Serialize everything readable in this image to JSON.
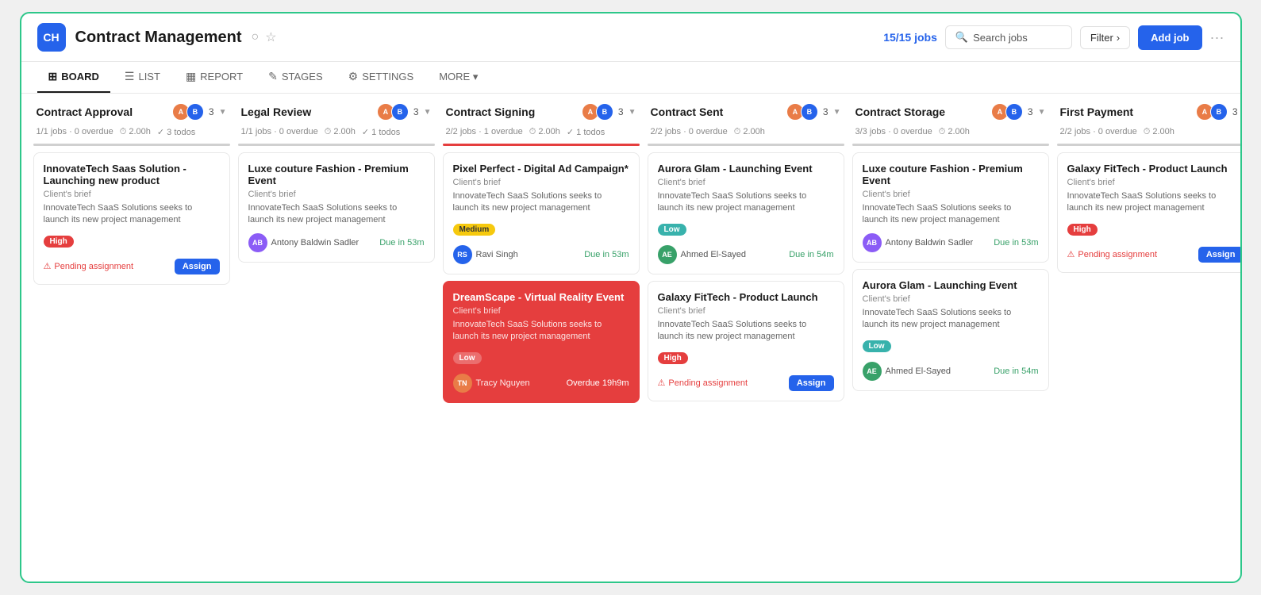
{
  "app": {
    "logo": "CH",
    "title": "Contract Management",
    "jobs_count": "15/15 jobs",
    "search_placeholder": "Search jobs",
    "filter_label": "Filter",
    "add_job_label": "Add job"
  },
  "nav": {
    "tabs": [
      {
        "id": "board",
        "label": "BOARD",
        "icon": "⊞",
        "active": true
      },
      {
        "id": "list",
        "label": "LIST",
        "icon": "☰",
        "active": false
      },
      {
        "id": "report",
        "label": "REPORT",
        "icon": "▦",
        "active": false
      },
      {
        "id": "stages",
        "label": "STAGES",
        "icon": "✎",
        "active": false
      },
      {
        "id": "settings",
        "label": "SETTINGS",
        "icon": "⚙",
        "active": false
      },
      {
        "id": "more",
        "label": "MORE",
        "icon": "",
        "active": false
      }
    ]
  },
  "columns": [
    {
      "id": "contract-approval",
      "title": "Contract Approval",
      "color": "#cccccc",
      "count": 3,
      "stats": "1/1 jobs · 0 overdue",
      "time": "2.00h",
      "todos": "3 todos",
      "cards": [
        {
          "id": "ca1",
          "title": "InnovateTech Saas Solution - Launching new product",
          "label": "Client's brief",
          "desc": "InnovateTech SaaS Solutions seeks to launch its new project management",
          "priority": "high",
          "priority_label": "High",
          "assignee": null,
          "due": null,
          "pending": true,
          "assign_label": "Assign"
        }
      ]
    },
    {
      "id": "legal-review",
      "title": "Legal Review",
      "color": "#cccccc",
      "count": 3,
      "stats": "1/1 jobs · 0 overdue",
      "time": "2.00h",
      "todos": "1 todos",
      "cards": [
        {
          "id": "lr1",
          "title": "Luxe couture Fashion - Premium Event",
          "label": "Client's brief",
          "desc": "InnovateTech SaaS Solutions seeks to launch its new project management",
          "priority": null,
          "priority_label": null,
          "assignee": "Antony Baldwin Sadler",
          "assignee_initials": "AB",
          "assignee_color": "#8b5cf6",
          "due": "Due in 53m",
          "due_type": "green",
          "pending": false
        }
      ]
    },
    {
      "id": "contract-signing",
      "title": "Contract Signing",
      "color": "#e53e3e",
      "count": 3,
      "stats": "2/2 jobs · 1 overdue",
      "time": "2.00h",
      "todos": "1 todos",
      "cards": [
        {
          "id": "cs1",
          "title": "Pixel Perfect - Digital Ad Campaign*",
          "label": "Client's brief",
          "desc": "InnovateTech SaaS Solutions seeks to launch its new project management",
          "priority": "medium",
          "priority_label": "Medium",
          "assignee": "Ravi Singh",
          "assignee_initials": "RS",
          "assignee_color": "#2563eb",
          "due": "Due in 53m",
          "due_type": "green",
          "pending": false,
          "highlighted": false
        },
        {
          "id": "cs2",
          "title": "DreamScape - Virtual Reality Event",
          "label": "Client's brief",
          "desc": "InnovateTech SaaS Solutions seeks to launch its new project management",
          "priority": "low",
          "priority_label": "Low",
          "assignee": "Tracy Nguyen",
          "assignee_initials": "TN",
          "assignee_color": "#e97c47",
          "due": "Overdue 19h9m",
          "due_type": "red",
          "pending": false,
          "highlighted": true
        }
      ]
    },
    {
      "id": "contract-sent",
      "title": "Contract Sent",
      "color": "#cccccc",
      "count": 3,
      "stats": "2/2 jobs · 0 overdue",
      "time": "2.00h",
      "todos": null,
      "cards": [
        {
          "id": "sent1",
          "title": "Aurora Glam - Launching Event",
          "label": "Client's brief",
          "desc": "InnovateTech SaaS Solutions seeks to launch its new project management",
          "priority": "low",
          "priority_label": "Low",
          "assignee": "Ahmed El-Sayed",
          "assignee_initials": "AE",
          "assignee_color": "#38a169",
          "due": "Due in 54m",
          "due_type": "green",
          "pending": false
        },
        {
          "id": "sent2",
          "title": "Galaxy FitTech - Product Launch",
          "label": "Client's brief",
          "desc": "InnovateTech SaaS Solutions seeks to launch its new project management",
          "priority": "high",
          "priority_label": "High",
          "assignee": null,
          "due": null,
          "pending": true,
          "assign_label": "Assign"
        }
      ]
    },
    {
      "id": "contract-storage",
      "title": "Contract Storage",
      "color": "#cccccc",
      "count": 3,
      "stats": "3/3 jobs · 0 overdue",
      "time": "2.00h",
      "todos": null,
      "cards": [
        {
          "id": "stor1",
          "title": "Luxe couture Fashion - Premium Event",
          "label": "Client's brief",
          "desc": "InnovateTech SaaS Solutions seeks to launch its new project management",
          "priority": null,
          "priority_label": null,
          "assignee": "Antony Baldwin Sadler",
          "assignee_initials": "AB",
          "assignee_color": "#8b5cf6",
          "due": "Due in 53m",
          "due_type": "green",
          "pending": false
        },
        {
          "id": "stor2",
          "title": "Aurora Glam - Launching Event",
          "label": "Client's brief",
          "desc": "InnovateTech SaaS Solutions seeks to launch its new project management",
          "priority": "low",
          "priority_label": "Low",
          "assignee": "Ahmed El-Sayed",
          "assignee_initials": "AE",
          "assignee_color": "#38a169",
          "due": "Due in 54m",
          "due_type": "green",
          "pending": false
        }
      ]
    },
    {
      "id": "first-payment",
      "title": "First Payment",
      "color": "#cccccc",
      "count": 3,
      "stats": "2/2 jobs · 0 overdue",
      "time": "2.00h",
      "todos": null,
      "cards": [
        {
          "id": "fp1",
          "title": "Galaxy FitTech - Product Launch",
          "label": "Client's brief",
          "desc": "InnovateTech SaaS Solutions seeks to launch its new project management",
          "priority": "high",
          "priority_label": "High",
          "assignee": null,
          "due": null,
          "pending": true,
          "assign_label": "Assign"
        }
      ]
    }
  ],
  "labels": {
    "pending_assignment": "Pending assignment",
    "client_brief": "Client's brief",
    "due_in": "Due in 53m",
    "overdue": "Overdue 19h9m"
  }
}
